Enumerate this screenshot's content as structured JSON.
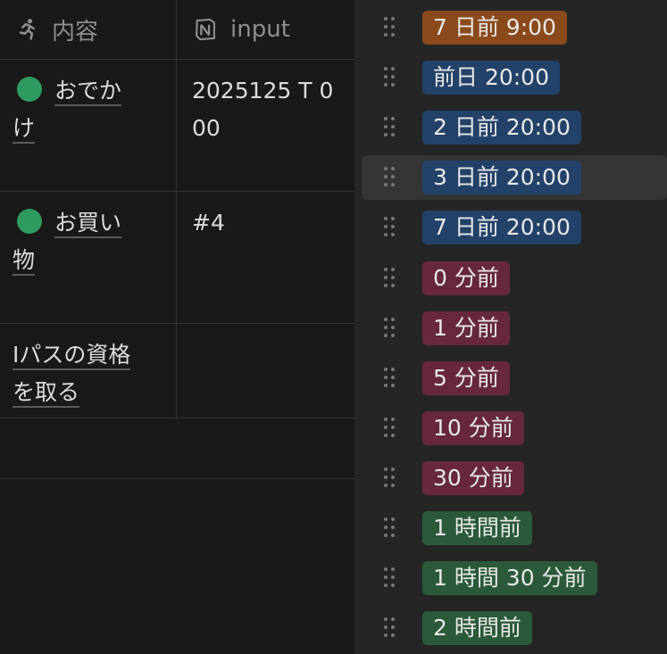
{
  "table": {
    "columns": [
      {
        "label": "内容",
        "icon": "running-person-icon"
      },
      {
        "label": "input",
        "icon": "notion-logo-icon"
      }
    ],
    "rows": [
      {
        "title": "おでかけ",
        "title_line1": "おでか",
        "title_line2": "け",
        "status_color": "#2f9a5f",
        "input": "2025125 T 000"
      },
      {
        "title": "お買い物",
        "title_line1": "お買い",
        "title_line2": "物",
        "status_color": "#2f9a5f",
        "input": "#4"
      },
      {
        "title": "Iパスの資格を取る",
        "title_line1": "Iパスの資格",
        "title_line2": "を取る",
        "status_color": null,
        "input": ""
      }
    ]
  },
  "dropdown": {
    "options": [
      {
        "label": "7 日前 9:00",
        "color": "#8a4a1b"
      },
      {
        "label": "前日 20:00",
        "color": "#22426a"
      },
      {
        "label": "2 日前 20:00",
        "color": "#22426a"
      },
      {
        "label": "3 日前 20:00",
        "color": "#22426a",
        "hovered": true
      },
      {
        "label": "7 日前 20:00",
        "color": "#22426a"
      },
      {
        "label": "0 分前",
        "color": "#67283f"
      },
      {
        "label": "1 分前",
        "color": "#67283f"
      },
      {
        "label": "5 分前",
        "color": "#67283f"
      },
      {
        "label": "10 分前",
        "color": "#67283f"
      },
      {
        "label": "30 分前",
        "color": "#67283f"
      },
      {
        "label": "1 時間前",
        "color": "#2a5a3a"
      },
      {
        "label": "1 時間 30 分前",
        "color": "#2a5a3a"
      },
      {
        "label": "2 時間前",
        "color": "#2a5a3a"
      }
    ]
  },
  "colors": {
    "background": "#191919",
    "menu_background": "#252525",
    "status_green": "#2f9a5f"
  }
}
